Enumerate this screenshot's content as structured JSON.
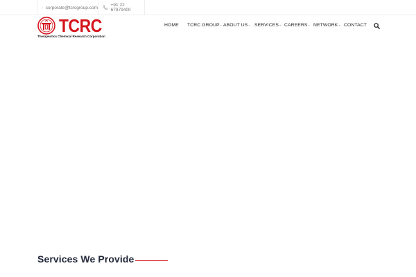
{
  "topbar": {
    "email": "corporate@tcrcgroup.com",
    "phone": "+91 22 67879400"
  },
  "logo": {
    "wordmark": "TCRC",
    "tagline": "Therapeutics Chemical Research Corporation"
  },
  "nav": {
    "items": [
      {
        "label": "HOME",
        "has_dropdown": false
      },
      {
        "label": "TCRC GROUP",
        "has_dropdown": true
      },
      {
        "label": "ABOUT US",
        "has_dropdown": true
      },
      {
        "label": "SERVICES",
        "has_dropdown": true
      },
      {
        "label": "CAREERS",
        "has_dropdown": true
      },
      {
        "label": "NETWORK",
        "has_dropdown": true
      },
      {
        "label": "CONTACT",
        "has_dropdown": false
      }
    ],
    "search_icon": "search-icon"
  },
  "section": {
    "title": "Services We Provide"
  },
  "colors": {
    "brand_red": "#d4141c",
    "heading": "#23283a"
  }
}
